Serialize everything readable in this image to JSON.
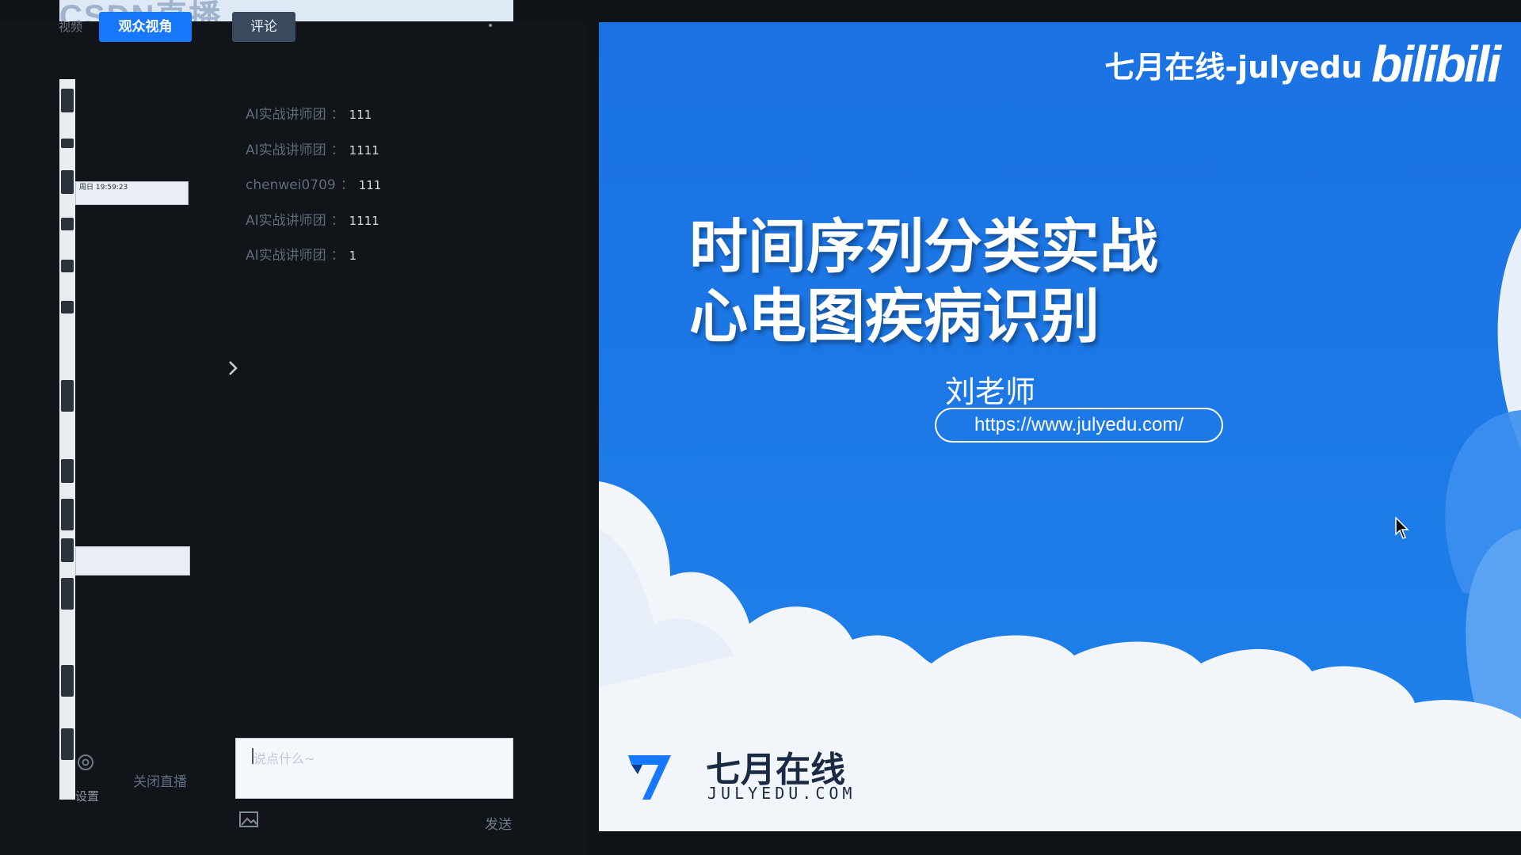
{
  "header": {
    "logo_text": "CSDN直播"
  },
  "tabs": {
    "partial_label": "视频",
    "audience_view": "观众视角",
    "comment": "评论"
  },
  "mini_panel": {
    "clock": "周日 19:59:23"
  },
  "comments": [
    {
      "user": "AI实战讲师团",
      "sep": "：",
      "msg": "111"
    },
    {
      "user": "AI实战讲师团",
      "sep": "：",
      "msg": "1111"
    },
    {
      "user": "chenwei0709",
      "sep": "：",
      "msg": "111"
    },
    {
      "user": "AI实战讲师团",
      "sep": "：",
      "msg": "1111"
    },
    {
      "user": "AI实战讲师团",
      "sep": "：",
      "msg": "1"
    }
  ],
  "bottom": {
    "settings_label": "设置",
    "close_live": "关闭直播",
    "input_placeholder": "说点什么~",
    "send": "发送"
  },
  "slide": {
    "brand": "七月在线-julyedu",
    "bilibili": "bilibili",
    "title_line1": "时间序列分类实战",
    "title_line2": "心电图疾病识别",
    "teacher": "刘老师",
    "url": "https://www.julyedu.com/",
    "footer_cn": "七月在线",
    "footer_en": "JULYEDU.COM"
  },
  "colors": {
    "accent_blue": "#1677ff",
    "slide_blue": "#1c78e6",
    "background": "#0f1216"
  }
}
